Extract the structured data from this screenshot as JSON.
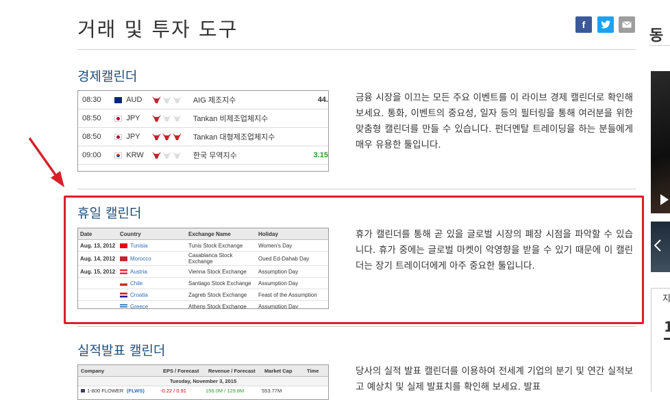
{
  "page": {
    "title": "거래 및 투자 도구"
  },
  "share": {
    "facebook_icon": "facebook-icon",
    "twitter_icon": "twitter-icon",
    "email_icon": "email-icon",
    "facebook_glyph": "f",
    "twitter_glyph": "t",
    "email_glyph": "✉",
    "facebook_color": "#3b5998",
    "twitter_color": "#1da1f2",
    "email_color": "#9e9e9e"
  },
  "sections": {
    "economic": {
      "title": "경제캘린더",
      "description": "금융 시장을 이끄는 모든 주요 이벤트를 이 라이브 경제 캘린더로 확인해 보세요. 통화, 이벤트의 중요성, 일자 등의 필터링을 통해 여러분을 위한 맞춤형 캘린더를 만들 수 있습니다. 펀더멘탈 트레이딩을 하는 분들에게 매우 유용한 툴입니다.",
      "rows": [
        {
          "time": "08:30",
          "currency": "AUD",
          "event": "AIG 제조지수",
          "value": "44."
        },
        {
          "time": "08:50",
          "currency": "JPY",
          "event": "Tankan 비제조업체지수",
          "value": ""
        },
        {
          "time": "08:50",
          "currency": "JPY",
          "event": "Tankan 대형제조업체지수",
          "value": ""
        },
        {
          "time": "09:00",
          "currency": "KRW",
          "event": "한국 무역지수",
          "value": "3.15"
        }
      ]
    },
    "holiday": {
      "title": "휴일 캘린더",
      "description": "휴가 캘린더를 통해 곧 있을 글로벌 시장의 폐장 시점을 파악할 수 있습니다. 휴가 중에는 글로벌 마켓이 악영향을 받을 수 있기 때문에 이 캘린더는 장기 트레이더에게 아주 중요한 툴입니다.",
      "headers": [
        "Date",
        "Country",
        "Exchange Name",
        "Holiday"
      ],
      "rows": [
        {
          "date": "Aug. 13, 2012",
          "country": "Tunisia",
          "exchange": "Tunis Stock Exchange",
          "holiday": "Women's Day"
        },
        {
          "date": "Aug. 14, 2012",
          "country": "Morocco",
          "exchange": "Casablanca Stock Exchange",
          "holiday": "Oued Ed-Dahab Day"
        },
        {
          "date": "Aug. 15, 2012",
          "country": "Austria",
          "exchange": "Vienna Stock Exchange",
          "holiday": "Assumption Day"
        },
        {
          "date": "",
          "country": "Chile",
          "exchange": "Santiago Stock Exchange",
          "holiday": "Assumption Day"
        },
        {
          "date": "",
          "country": "Croatia",
          "exchange": "Zagreb Stock Exchange",
          "holiday": "Feast of the Assumption"
        },
        {
          "date": "",
          "country": "Greece",
          "exchange": "Athens Stock Exchange",
          "holiday": "Assumption Day"
        }
      ]
    },
    "earnings": {
      "title": "실적발표 캘린더",
      "description": "당사의 실적 발표 캘린더를 이용하여 전세계 기업의 분기 및 연간 실적보고 예상치 및 실제 발표치를 확인해 보세요. 발표",
      "headers": [
        "Company",
        "EPS / Forecast",
        "Revenue / Forecast",
        "Market Cap",
        "Time"
      ],
      "date_row": "Tuesday, November 3, 2015",
      "rows": [
        {
          "company": "1-800 FLOWER",
          "ticker": "(FLWS)",
          "eps": "-0.22 / 0.91",
          "revenue": "156.0M / 129.8M",
          "cap": "553.77M"
        }
      ]
    }
  },
  "sidebar": {
    "heading_partial": "동",
    "text_partial_1": "지",
    "text_partial_2": "1"
  }
}
